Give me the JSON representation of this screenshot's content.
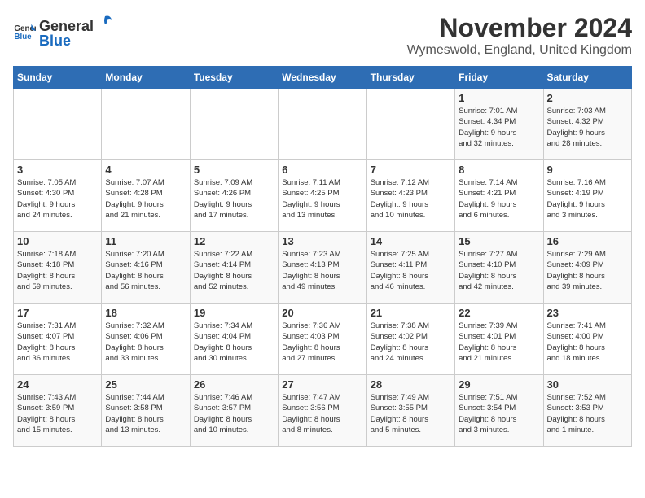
{
  "logo": {
    "general": "General",
    "blue": "Blue"
  },
  "title": "November 2024",
  "location": "Wymeswold, England, United Kingdom",
  "days_of_week": [
    "Sunday",
    "Monday",
    "Tuesday",
    "Wednesday",
    "Thursday",
    "Friday",
    "Saturday"
  ],
  "weeks": [
    [
      {
        "num": "",
        "detail": ""
      },
      {
        "num": "",
        "detail": ""
      },
      {
        "num": "",
        "detail": ""
      },
      {
        "num": "",
        "detail": ""
      },
      {
        "num": "",
        "detail": ""
      },
      {
        "num": "1",
        "detail": "Sunrise: 7:01 AM\nSunset: 4:34 PM\nDaylight: 9 hours\nand 32 minutes."
      },
      {
        "num": "2",
        "detail": "Sunrise: 7:03 AM\nSunset: 4:32 PM\nDaylight: 9 hours\nand 28 minutes."
      }
    ],
    [
      {
        "num": "3",
        "detail": "Sunrise: 7:05 AM\nSunset: 4:30 PM\nDaylight: 9 hours\nand 24 minutes."
      },
      {
        "num": "4",
        "detail": "Sunrise: 7:07 AM\nSunset: 4:28 PM\nDaylight: 9 hours\nand 21 minutes."
      },
      {
        "num": "5",
        "detail": "Sunrise: 7:09 AM\nSunset: 4:26 PM\nDaylight: 9 hours\nand 17 minutes."
      },
      {
        "num": "6",
        "detail": "Sunrise: 7:11 AM\nSunset: 4:25 PM\nDaylight: 9 hours\nand 13 minutes."
      },
      {
        "num": "7",
        "detail": "Sunrise: 7:12 AM\nSunset: 4:23 PM\nDaylight: 9 hours\nand 10 minutes."
      },
      {
        "num": "8",
        "detail": "Sunrise: 7:14 AM\nSunset: 4:21 PM\nDaylight: 9 hours\nand 6 minutes."
      },
      {
        "num": "9",
        "detail": "Sunrise: 7:16 AM\nSunset: 4:19 PM\nDaylight: 9 hours\nand 3 minutes."
      }
    ],
    [
      {
        "num": "10",
        "detail": "Sunrise: 7:18 AM\nSunset: 4:18 PM\nDaylight: 8 hours\nand 59 minutes."
      },
      {
        "num": "11",
        "detail": "Sunrise: 7:20 AM\nSunset: 4:16 PM\nDaylight: 8 hours\nand 56 minutes."
      },
      {
        "num": "12",
        "detail": "Sunrise: 7:22 AM\nSunset: 4:14 PM\nDaylight: 8 hours\nand 52 minutes."
      },
      {
        "num": "13",
        "detail": "Sunrise: 7:23 AM\nSunset: 4:13 PM\nDaylight: 8 hours\nand 49 minutes."
      },
      {
        "num": "14",
        "detail": "Sunrise: 7:25 AM\nSunset: 4:11 PM\nDaylight: 8 hours\nand 46 minutes."
      },
      {
        "num": "15",
        "detail": "Sunrise: 7:27 AM\nSunset: 4:10 PM\nDaylight: 8 hours\nand 42 minutes."
      },
      {
        "num": "16",
        "detail": "Sunrise: 7:29 AM\nSunset: 4:09 PM\nDaylight: 8 hours\nand 39 minutes."
      }
    ],
    [
      {
        "num": "17",
        "detail": "Sunrise: 7:31 AM\nSunset: 4:07 PM\nDaylight: 8 hours\nand 36 minutes."
      },
      {
        "num": "18",
        "detail": "Sunrise: 7:32 AM\nSunset: 4:06 PM\nDaylight: 8 hours\nand 33 minutes."
      },
      {
        "num": "19",
        "detail": "Sunrise: 7:34 AM\nSunset: 4:04 PM\nDaylight: 8 hours\nand 30 minutes."
      },
      {
        "num": "20",
        "detail": "Sunrise: 7:36 AM\nSunset: 4:03 PM\nDaylight: 8 hours\nand 27 minutes."
      },
      {
        "num": "21",
        "detail": "Sunrise: 7:38 AM\nSunset: 4:02 PM\nDaylight: 8 hours\nand 24 minutes."
      },
      {
        "num": "22",
        "detail": "Sunrise: 7:39 AM\nSunset: 4:01 PM\nDaylight: 8 hours\nand 21 minutes."
      },
      {
        "num": "23",
        "detail": "Sunrise: 7:41 AM\nSunset: 4:00 PM\nDaylight: 8 hours\nand 18 minutes."
      }
    ],
    [
      {
        "num": "24",
        "detail": "Sunrise: 7:43 AM\nSunset: 3:59 PM\nDaylight: 8 hours\nand 15 minutes."
      },
      {
        "num": "25",
        "detail": "Sunrise: 7:44 AM\nSunset: 3:58 PM\nDaylight: 8 hours\nand 13 minutes."
      },
      {
        "num": "26",
        "detail": "Sunrise: 7:46 AM\nSunset: 3:57 PM\nDaylight: 8 hours\nand 10 minutes."
      },
      {
        "num": "27",
        "detail": "Sunrise: 7:47 AM\nSunset: 3:56 PM\nDaylight: 8 hours\nand 8 minutes."
      },
      {
        "num": "28",
        "detail": "Sunrise: 7:49 AM\nSunset: 3:55 PM\nDaylight: 8 hours\nand 5 minutes."
      },
      {
        "num": "29",
        "detail": "Sunrise: 7:51 AM\nSunset: 3:54 PM\nDaylight: 8 hours\nand 3 minutes."
      },
      {
        "num": "30",
        "detail": "Sunrise: 7:52 AM\nSunset: 3:53 PM\nDaylight: 8 hours\nand 1 minute."
      }
    ]
  ]
}
